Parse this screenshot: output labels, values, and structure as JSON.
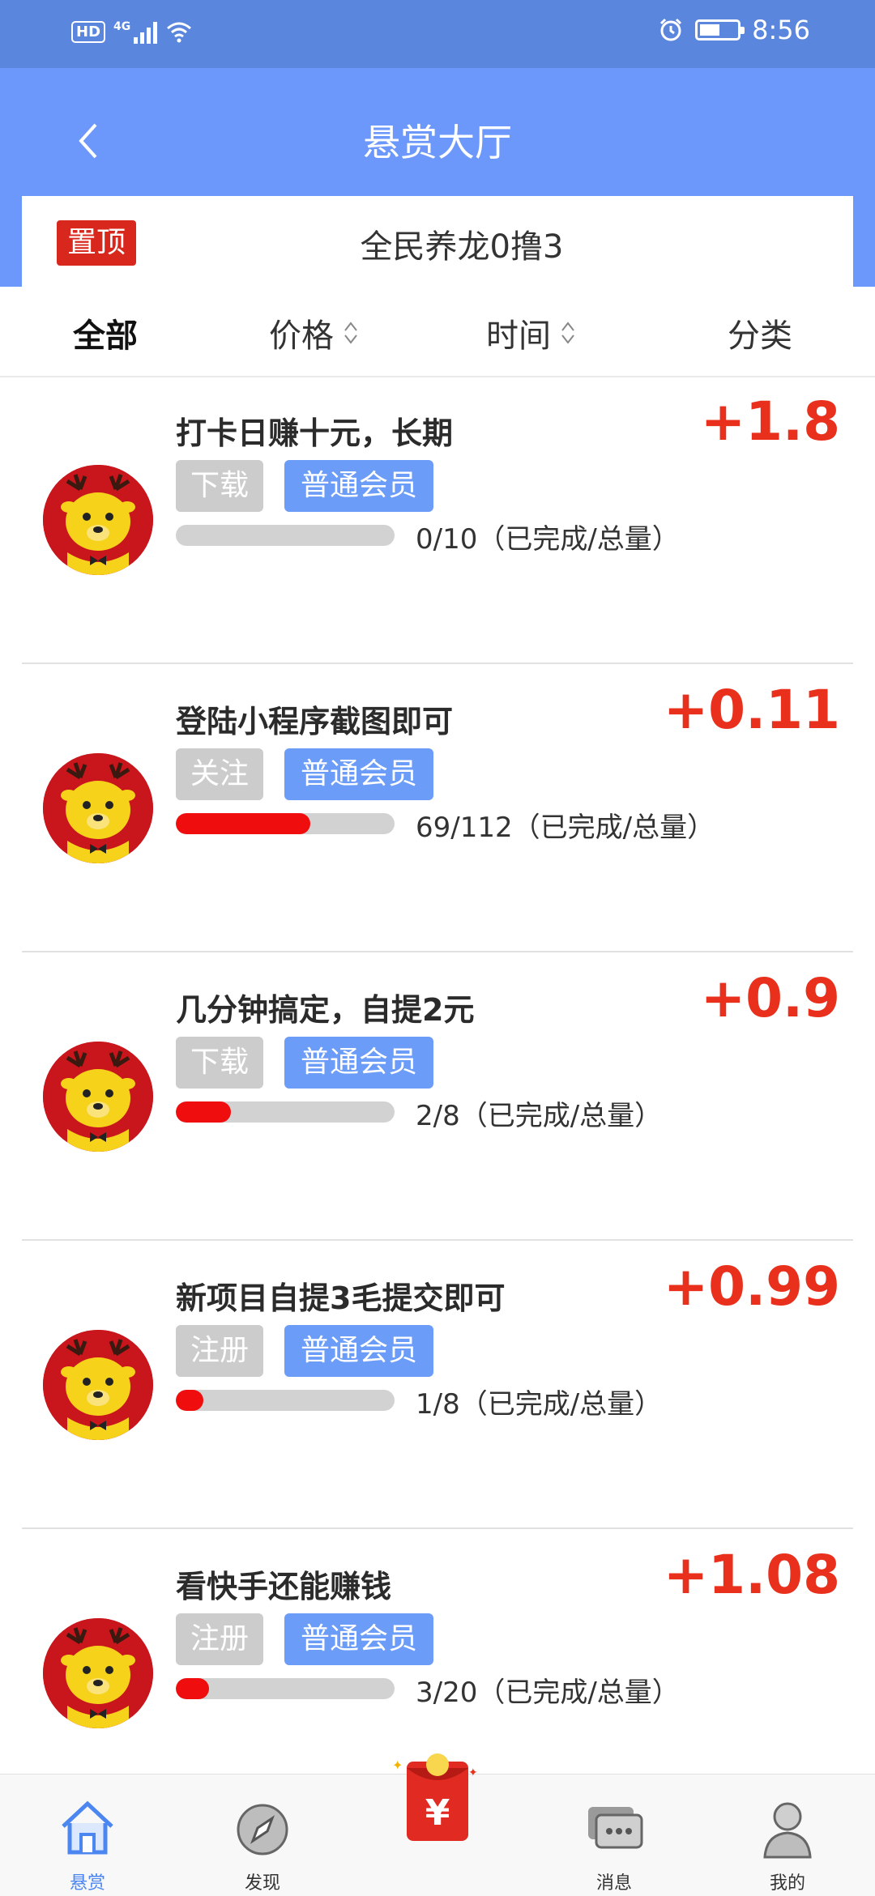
{
  "status": {
    "time": "8:56",
    "hd": "HD",
    "net": "4G"
  },
  "header": {
    "title": "悬赏大厅"
  },
  "pinned": {
    "badge": "置顶",
    "title": "全民养龙0撸3"
  },
  "filters": [
    {
      "label": "全部"
    },
    {
      "label": "价格"
    },
    {
      "label": "时间"
    },
    {
      "label": "分类"
    }
  ],
  "tasks": [
    {
      "title": "打卡日赚十元，长期",
      "reward": "+1.8",
      "type": "下载",
      "level": "普通会员",
      "done": 0,
      "total": 10,
      "progress_text": "0/10（已完成/总量）"
    },
    {
      "title": "登陆小程序截图即可",
      "reward": "+0.11",
      "type": "关注",
      "level": "普通会员",
      "done": 69,
      "total": 112,
      "progress_text": "69/112（已完成/总量）"
    },
    {
      "title": "几分钟搞定，自提2元",
      "reward": "+0.9",
      "type": "下载",
      "level": "普通会员",
      "done": 2,
      "total": 8,
      "progress_text": "2/8（已完成/总量）"
    },
    {
      "title": "新项目自提3毛提交即可",
      "reward": "+0.99",
      "type": "注册",
      "level": "普通会员",
      "done": 1,
      "total": 8,
      "progress_text": "1/8（已完成/总量）"
    },
    {
      "title": "看快手还能赚钱",
      "reward": "+1.08",
      "type": "注册",
      "level": "普通会员",
      "done": 3,
      "total": 20,
      "progress_text": "3/20（已完成/总量）"
    }
  ],
  "tabbar": {
    "items": [
      {
        "label": "悬赏",
        "icon": "home-icon"
      },
      {
        "label": "发现",
        "icon": "compass-icon"
      },
      {
        "label": "消息",
        "icon": "chat-icon"
      },
      {
        "label": "我的",
        "icon": "user-icon"
      }
    ],
    "center_icon": "red-packet-icon",
    "center_symbol": "¥"
  },
  "colors": {
    "header": "#6c98fb",
    "status": "#5a86dd",
    "reward": "#e8301c",
    "tag_level": "#6b9cf7",
    "progress": "#f00d0d"
  }
}
